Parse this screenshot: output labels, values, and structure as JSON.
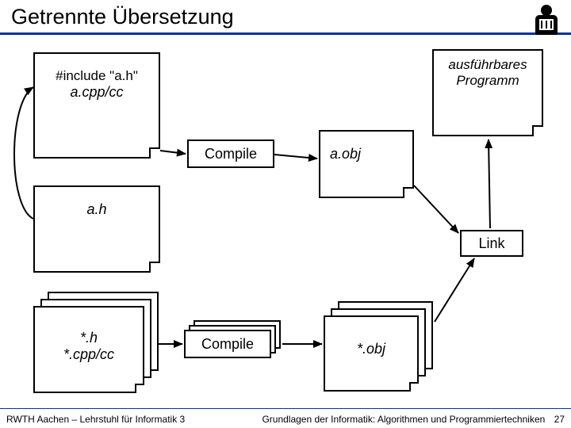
{
  "header": {
    "title": "Getrennte Übersetzung"
  },
  "nodes": {
    "a_src": {
      "line1": "#include \"a.h\"",
      "line2": "a.cpp/cc"
    },
    "a_header": "a.h",
    "exe": {
      "line1": "ausführbares",
      "line2": "Programm"
    },
    "compile1": "Compile",
    "compile2": "Compile",
    "a_obj": "a.obj",
    "star_obj": "*.obj",
    "link": "Link",
    "star_src": {
      "line1": "*.h",
      "line2": "*.cpp/cc"
    }
  },
  "footer": {
    "left": "RWTH Aachen – Lehrstuhl für Informatik 3",
    "right": "Grundlagen der Informatik: Algorithmen und Programmiertechniken",
    "page": "27"
  }
}
